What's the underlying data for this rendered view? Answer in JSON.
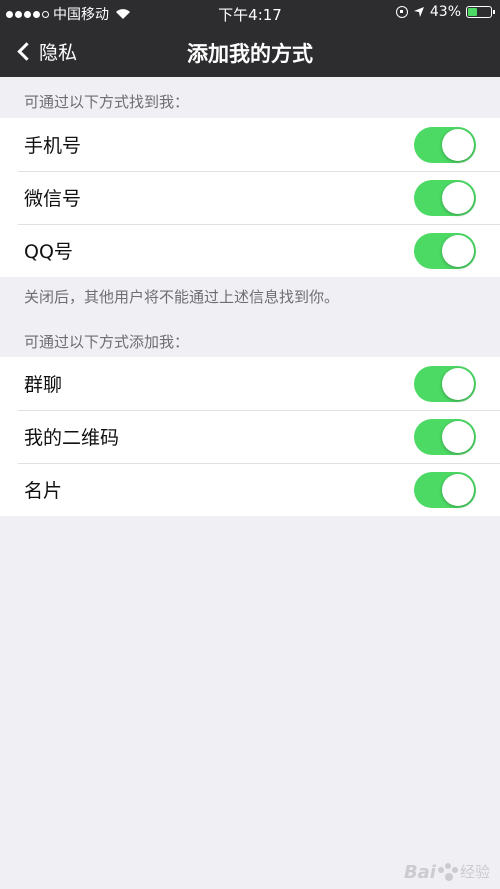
{
  "status_bar": {
    "carrier": "中国移动",
    "time": "下午4:17",
    "battery": "43%",
    "battery_level": 0.43
  },
  "nav": {
    "back_label": "隐私",
    "title": "添加我的方式"
  },
  "section1": {
    "header": "可通过以下方式找到我：",
    "items": [
      {
        "label": "手机号",
        "on": true
      },
      {
        "label": "微信号",
        "on": true
      },
      {
        "label": "QQ号",
        "on": true
      }
    ],
    "footer": "关闭后，其他用户将不能通过上述信息找到你。"
  },
  "section2": {
    "header": "可通过以下方式添加我：",
    "items": [
      {
        "label": "群聊",
        "on": true
      },
      {
        "label": "我的二维码",
        "on": true
      },
      {
        "label": "名片",
        "on": true
      }
    ]
  },
  "watermark": {
    "brand": "Bai",
    "text": "经验"
  },
  "colors": {
    "accent": "#4cd964",
    "nav_bg": "#2d2d30",
    "page_bg": "#efeff4"
  }
}
